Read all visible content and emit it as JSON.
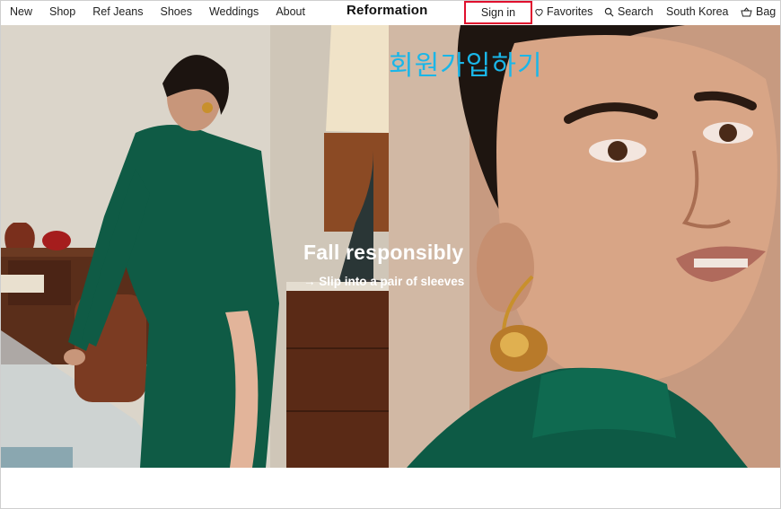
{
  "header": {
    "nav_left": [
      "New",
      "Shop",
      "Ref Jeans",
      "Shoes",
      "Weddings",
      "About"
    ],
    "brand": "Reformation",
    "sign_in": "Sign in",
    "favorites": "Favorites",
    "search": "Search",
    "region": "South Korea",
    "bag": "Bag"
  },
  "hero": {
    "title": "Fall responsibly",
    "cta": "→ Slip into a pair of sleeves"
  },
  "annotation": {
    "text": "회원가입하기",
    "color": "#1ab6e8",
    "highlight_color": "#e0102e"
  }
}
